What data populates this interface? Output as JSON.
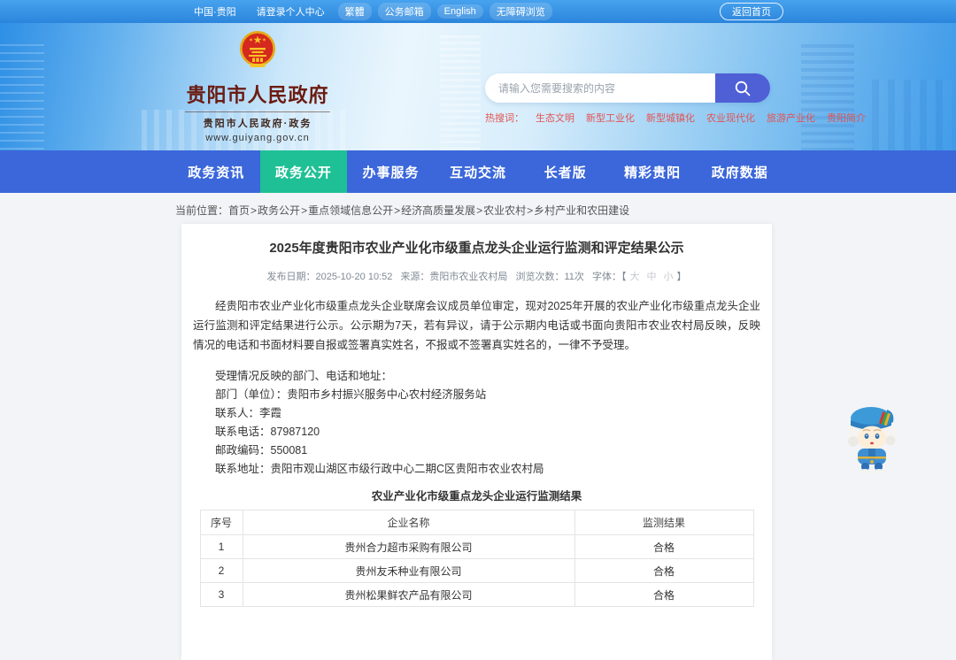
{
  "topbar": {
    "links": [
      {
        "label": "中国·贵阳",
        "pill": false
      },
      {
        "label": "请登录个人中心",
        "pill": false
      },
      {
        "label": "繁體",
        "pill": true
      },
      {
        "label": "公务邮箱",
        "pill": true
      },
      {
        "label": "English",
        "pill": true
      },
      {
        "label": "无障碍浏览",
        "pill": true
      }
    ],
    "home_button": "返回首页"
  },
  "header": {
    "site_title": "贵阳市人民政府",
    "site_subtitle": "贵阳市人民政府·政务",
    "site_url": "www.guiyang.gov.cn",
    "search": {
      "placeholder": "请输入您需要搜索的内容"
    },
    "hot_search": {
      "label": "热搜词：",
      "items": [
        "生态文明",
        "新型工业化",
        "新型城镇化",
        "农业现代化",
        "旅游产业化",
        "贵阳简介"
      ]
    }
  },
  "nav": {
    "items": [
      {
        "label": "政务资讯",
        "active": false
      },
      {
        "label": "政务公开",
        "active": true
      },
      {
        "label": "办事服务",
        "active": false
      },
      {
        "label": "互动交流",
        "active": false
      },
      {
        "label": "长者版",
        "active": false
      },
      {
        "label": "精彩贵阳",
        "active": false
      },
      {
        "label": "政府数据",
        "active": false
      }
    ]
  },
  "breadcrumb": {
    "label": "当前位置：",
    "items": [
      "首页",
      "政务公开",
      "重点领域信息公开",
      "经济高质量发展",
      "农业农村",
      "乡村产业和农田建设"
    ]
  },
  "article": {
    "title": "2025年度贵阳市农业产业化市级重点龙头企业运行监测和评定结果公示",
    "meta": {
      "publish": "发布日期：2025-10-20 10:52",
      "source": "来源：贵阳市农业农村局",
      "views": "浏览次数：11次",
      "font_label": "字体：【",
      "font_sizes": [
        "大",
        "中",
        "小"
      ],
      "font_close": "】"
    },
    "paragraphs": [
      "经贵阳市农业产业化市级重点龙头企业联席会议成员单位审定，现对2025年开展的农业产业化市级重点龙头企业运行监测和评定结果进行公示。公示期为7天，若有异议，请于公示期内电话或书面向贵阳市农业农村局反映，反映情况的电话和书面材料要自报或签署真实姓名，不报或不签署真实姓名的，一律不予受理。"
    ],
    "contact_lines": [
      "受理情况反映的部门、电话和地址：",
      "部门（单位）：贵阳市乡村振兴服务中心农村经济服务站",
      "联系人：李霞",
      "联系电话：87987120",
      "邮政编码：550081",
      "联系地址：贵阳市观山湖区市级行政中心二期C区贵阳市农业农村局"
    ],
    "table": {
      "title": "农业产业化市级重点龙头企业运行监测结果",
      "headers": [
        "序号",
        "企业名称",
        "监测结果"
      ],
      "rows": [
        [
          "1",
          "贵州合力超市采购有限公司",
          "合格"
        ],
        [
          "2",
          "贵州友禾种业有限公司",
          "合格"
        ],
        [
          "3",
          "贵州松果鲜农产品有限公司",
          "合格"
        ]
      ]
    }
  },
  "colors": {
    "topbar_blue": "#2f8ade",
    "nav_blue": "#3b67da",
    "nav_active_green": "#1fc095",
    "search_button_purple": "#4f5fd5",
    "hotword_red": "#e25454",
    "site_title_maroon": "#6b1c12"
  }
}
